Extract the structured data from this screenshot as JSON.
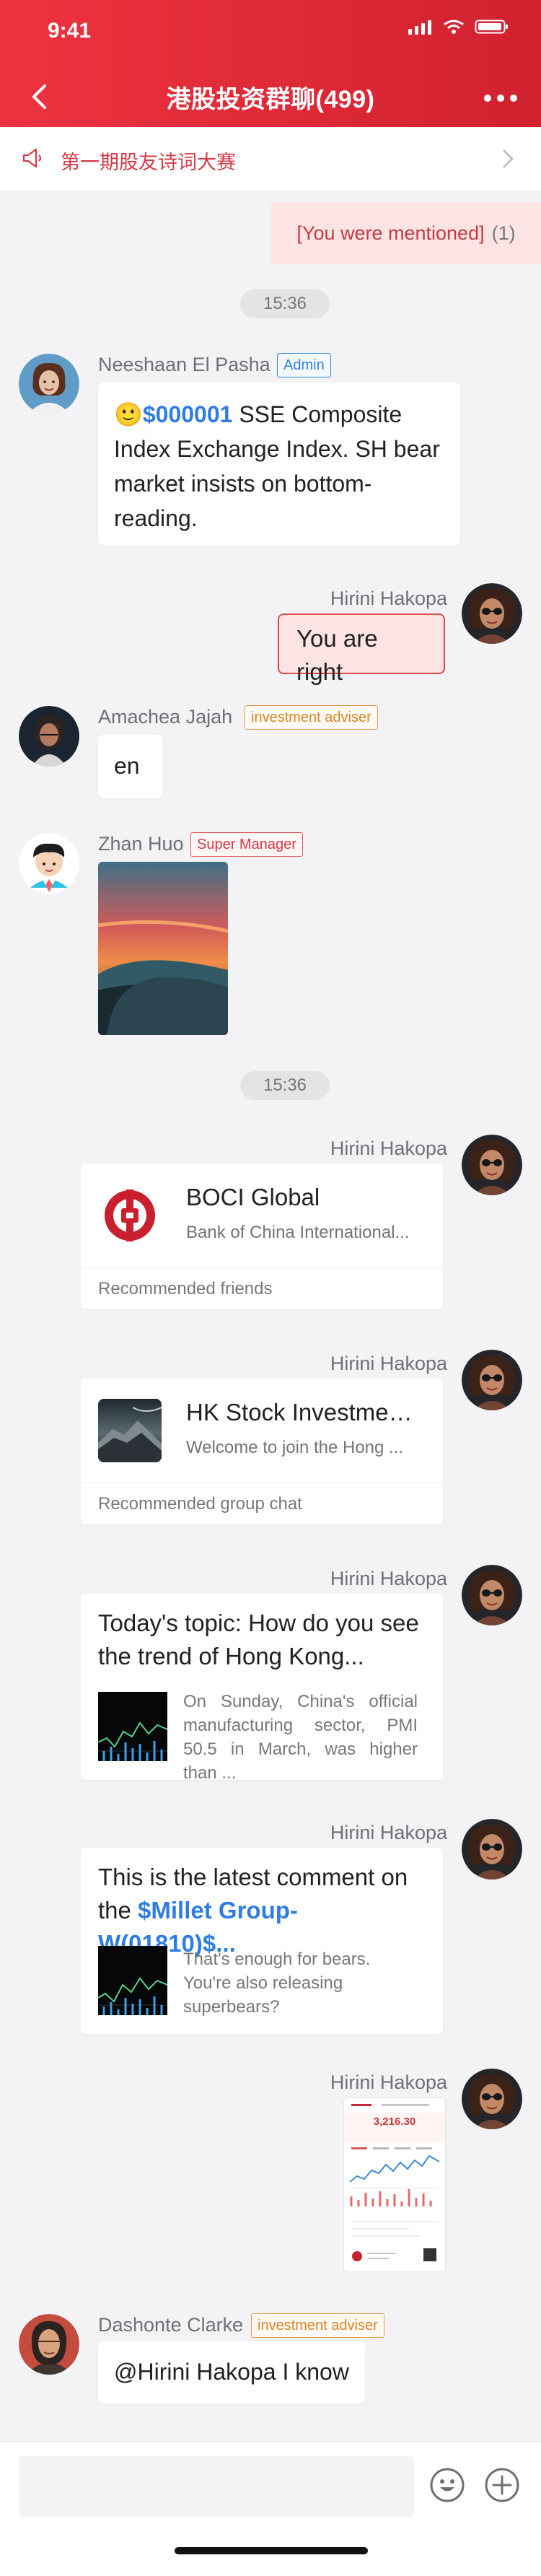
{
  "status": {
    "time": "9:41"
  },
  "header": {
    "title": "港股投资群聊(499)",
    "back_icon": "back-arrow-icon",
    "more_icon": "more-dots-icon"
  },
  "announcement": {
    "text": "第一期股友诗词大赛",
    "icon": "speaker-icon"
  },
  "mention": {
    "label": "[You were mentioned]",
    "count": "(1)"
  },
  "time_chips": {
    "first": "15:36",
    "second": "15:36"
  },
  "messages": {
    "m1": {
      "sender": "Neeshaan El Pasha",
      "badge": "Admin",
      "emoji": "🙂",
      "stock": "$000001",
      "text": " SSE Composite Index Exchange Index. SH bear market insists on bottom-reading."
    },
    "m2": {
      "sender": "Hirini Hakopa",
      "text": "You are right"
    },
    "m3": {
      "sender": "Amachea Jajah",
      "badge": "investment adviser",
      "text": "en"
    },
    "m4": {
      "sender": "Zhan Huo",
      "badge": "Super Manager"
    },
    "m5": {
      "sender": "Hirini Hakopa",
      "card_title": "BOCI Global",
      "card_sub": "Bank of China International...",
      "card_foot": "Recommended friends"
    },
    "m6": {
      "sender": "Hirini Hakopa",
      "card_title": "HK Stock Investment...",
      "card_sub": "Welcome to join the Hong ...",
      "card_foot": "Recommended group chat"
    },
    "m7": {
      "sender": "Hirini Hakopa",
      "title": "Today's topic: How do you see the trend of Hong Kong...",
      "desc": "On Sunday, China's official manufacturing sector, PMI 50.5 in March, was higher than ..."
    },
    "m8": {
      "sender": "Hirini Hakopa",
      "title_prefix": "This is the latest comment on the ",
      "title_stock": "$Millet Group-W(01810)$...",
      "desc": "That's enough for bears. You're also releasing superbears?"
    },
    "m9": {
      "sender": "Hirini Hakopa",
      "image_value": "3,216.30"
    },
    "m10": {
      "sender": "Dashonte Clarke",
      "badge": "investment adviser",
      "text": "@Hirini Hakopa I know"
    }
  },
  "colors": {
    "brand": "#e7303d",
    "accent": "#2f7de2"
  }
}
